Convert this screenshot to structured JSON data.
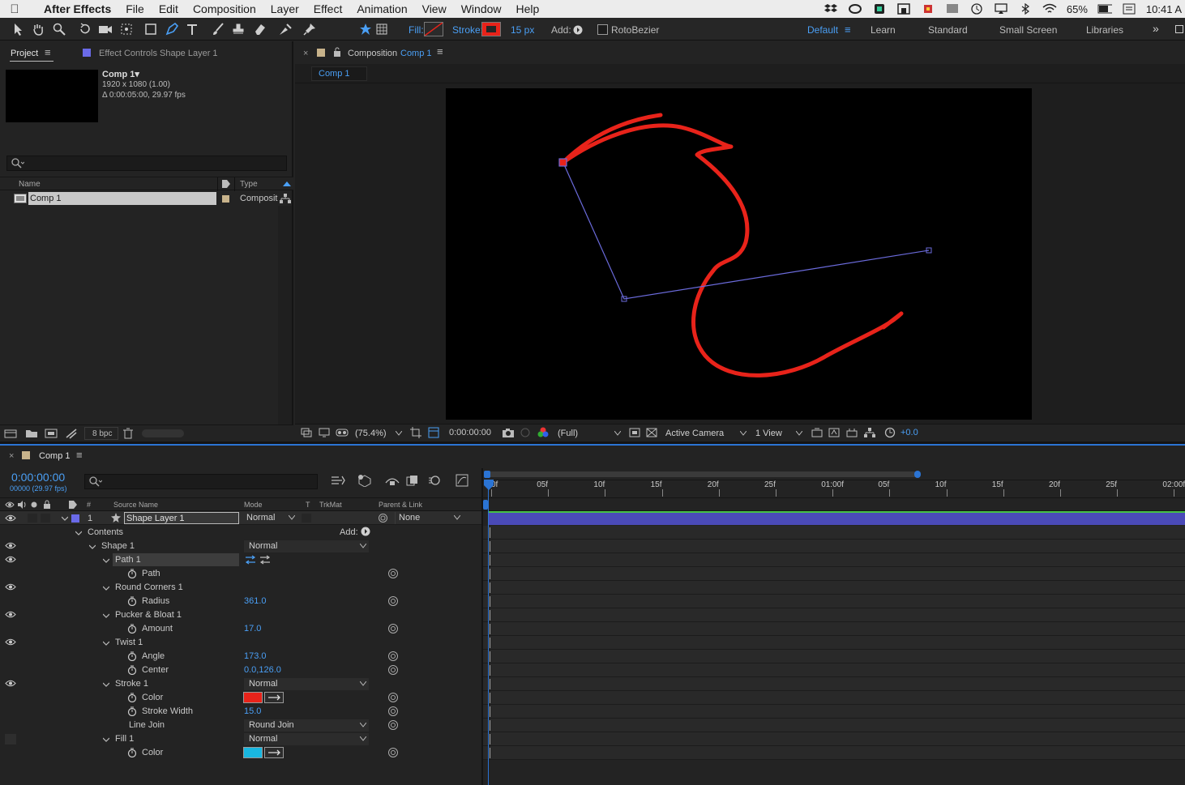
{
  "menubar": {
    "app_name": "After Effects",
    "items": [
      "File",
      "Edit",
      "Composition",
      "Layer",
      "Effect",
      "Animation",
      "View",
      "Window",
      "Help"
    ],
    "battery": "65%",
    "time": "10:41 A"
  },
  "toolbar": {
    "fill_label": "Fill:",
    "stroke_label": "Stroke:",
    "stroke_width": "15 px",
    "add_label": "Add:",
    "rotobezier_label": "RotoBezier",
    "workspaces": [
      "Default",
      "Learn",
      "Standard",
      "Small Screen",
      "Libraries"
    ],
    "stroke_color": "#e8231a",
    "accent_color": "#4a9ff5"
  },
  "project_panel": {
    "tab_project": "Project",
    "tab_effect_controls": "Effect Controls Shape Layer 1",
    "comp_name": "Comp 1▾",
    "comp_resolution": "1920 x 1080 (1.00)",
    "comp_duration": "Δ 0:00:05:00, 29.97 fps",
    "search_placeholder": "",
    "col_name": "Name",
    "col_type": "Type",
    "item_name": "Comp 1",
    "item_type": "Composit",
    "bit_depth": "8 bpc"
  },
  "composition_panel": {
    "tab_prefix": "Composition",
    "tab_comp": "Comp 1",
    "sub_tab": "Comp 1",
    "zoom": "(75.4%)",
    "timecode": "0:00:00:00",
    "resolution": "(Full)",
    "camera": "Active Camera",
    "views": "1 View",
    "exposure": "+0.0"
  },
  "timeline": {
    "tab_label": "Comp 1",
    "current_time": "0:00:00:00",
    "frame_info": "00000 (29.97 fps)",
    "search_placeholder": "",
    "col_hash": "#",
    "col_source_name": "Source Name",
    "col_mode": "Mode",
    "col_t": "T",
    "col_trkmat": "TrkMat",
    "col_parent": "Parent & Link",
    "layer_number": "1",
    "layer_name": "Shape Layer 1",
    "layer_mode": "Normal",
    "layer_parent": "None",
    "ruler_ticks": [
      "0f",
      "05f",
      "10f",
      "15f",
      "20f",
      "25f",
      "01:00f",
      "05f",
      "10f",
      "15f",
      "20f",
      "25f",
      "02:00f"
    ],
    "properties": {
      "contents": "Contents",
      "add_label": "Add:",
      "shape1": "Shape 1",
      "shape1_mode": "Normal",
      "path1": "Path 1",
      "path": "Path",
      "round_corners": "Round Corners 1",
      "radius_label": "Radius",
      "radius_value": "361.0",
      "pucker": "Pucker & Bloat 1",
      "amount_label": "Amount",
      "amount_value": "17.0",
      "twist": "Twist 1",
      "angle_label": "Angle",
      "angle_value": "173.0",
      "center_label": "Center",
      "center_value": "0.0,126.0",
      "stroke1": "Stroke 1",
      "stroke1_mode": "Normal",
      "stroke_color_label": "Color",
      "stroke_width_label": "Stroke Width",
      "stroke_width_value": "15.0",
      "line_join_label": "Line Join",
      "line_join_value": "Round Join",
      "fill1": "Fill 1",
      "fill1_mode": "Normal",
      "fill_color_label": "Color",
      "stroke_swatch": "#e8231a",
      "fill_swatch": "#19b7e0"
    }
  }
}
